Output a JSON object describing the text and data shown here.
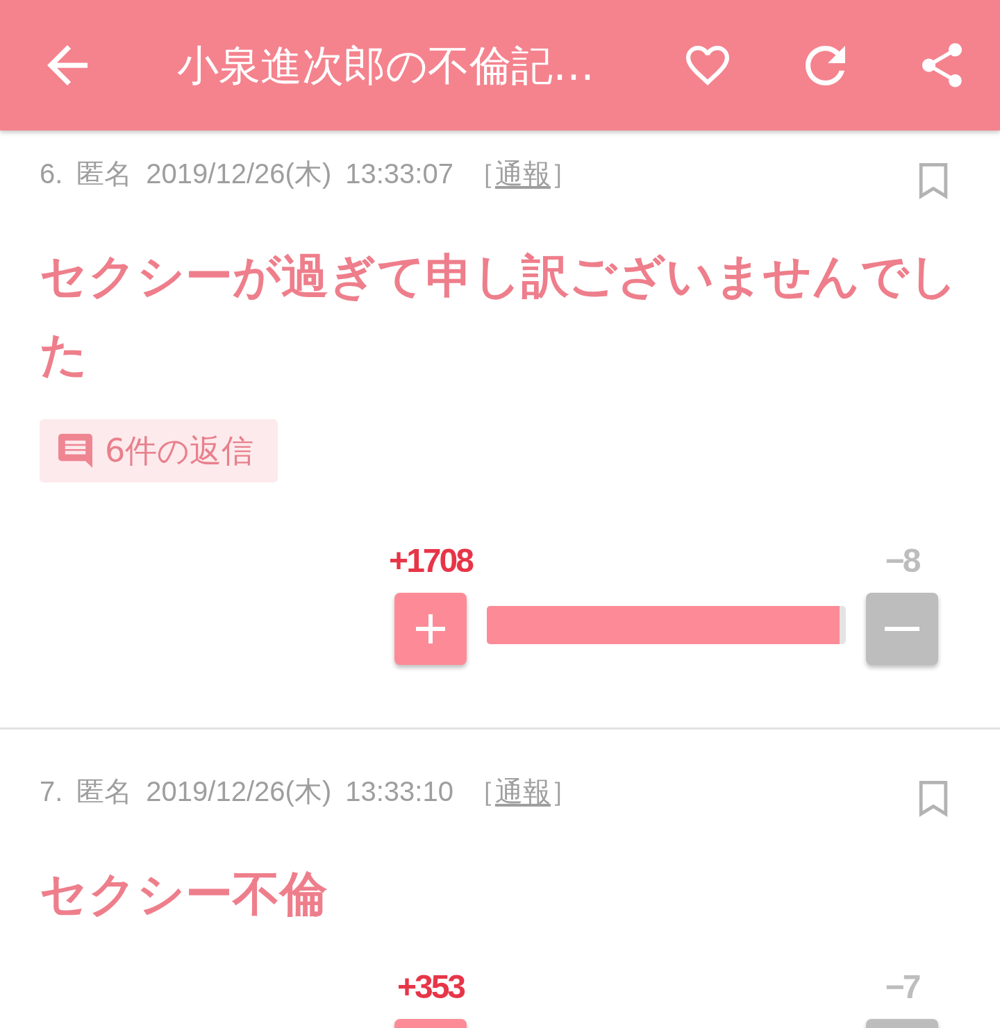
{
  "top_bar": {
    "title": "小泉進次郎の不倫記…"
  },
  "comments": [
    {
      "number": "6.",
      "author": "匿名",
      "date": "2019/12/26(木)",
      "time": "13:33:07",
      "report_link": {
        "open": "［",
        "label": "通報",
        "close": "］"
      },
      "bookmarked": false,
      "body": "セクシーが過ぎて申し訳ございませんでした",
      "replies": "6件の返信",
      "votes": {
        "plus": "+1708",
        "minus": "−8",
        "level": 0.983
      }
    },
    {
      "number": "7.",
      "author": "匿名",
      "date": "2019/12/26(木)",
      "time": "13:33:10",
      "report_link": {
        "open": "［",
        "label": "通報",
        "close": "］"
      },
      "bookmarked": false,
      "body": "セクシー不倫",
      "votes": {
        "plus": "+353",
        "minus": "−7"
      }
    }
  ]
}
